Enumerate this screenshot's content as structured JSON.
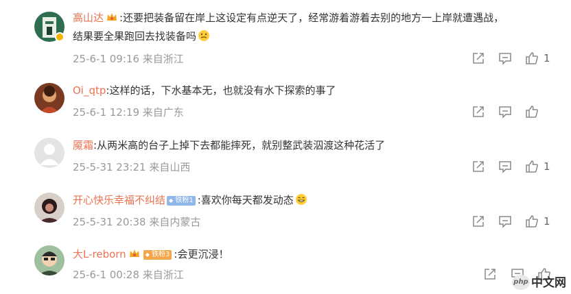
{
  "comments": [
    {
      "username": "高山达",
      "text_line1": ":还要把装备留在岸上这设定有点逆天了，经常游着游着去别的地方一上岸就遭遇战，",
      "text_line2": "结果要全果跑回去找装备吗",
      "date": "25-6-1 09:16",
      "location": "来自浙江",
      "likes": "1",
      "avatar_color": "#2f6d4f"
    },
    {
      "username": "Oi_qtp",
      "text_line1": ":这样的话，下水基本无，也就没有水下探索的事了",
      "date": "25-6-1 12:19",
      "location": "来自广东",
      "likes": "",
      "avatar_color": "#b05a3a"
    },
    {
      "username": "魇霜",
      "text_line1": ":从两米高的台子上掉下去都能摔死，就别整武装泅渡这种花活了",
      "date": "25-5-31 23:21",
      "location": "来自山西",
      "likes": "1",
      "avatar_color": "#dcdcdc"
    },
    {
      "username": "开心快乐幸福不纠结",
      "badge": "铁粉1",
      "text_line1": ":喜欢你每天都发动态",
      "date": "25-5-31 20:38",
      "location": "来自内蒙古",
      "likes": "1",
      "avatar_color": "#3a2a2a"
    },
    {
      "username": "大L-reborn",
      "badge": "铁粉3",
      "text_line1": ":会更沉浸！",
      "date": "25-6-1 00:28",
      "location": "来自浙江",
      "likes": "",
      "avatar_color": "#5a7a5a"
    }
  ],
  "watermark": {
    "logo_text": "php",
    "site_text": "中文网"
  },
  "icons": [
    "share-icon",
    "comment-icon",
    "like-icon",
    "crown-icon",
    "emoji-icon"
  ]
}
